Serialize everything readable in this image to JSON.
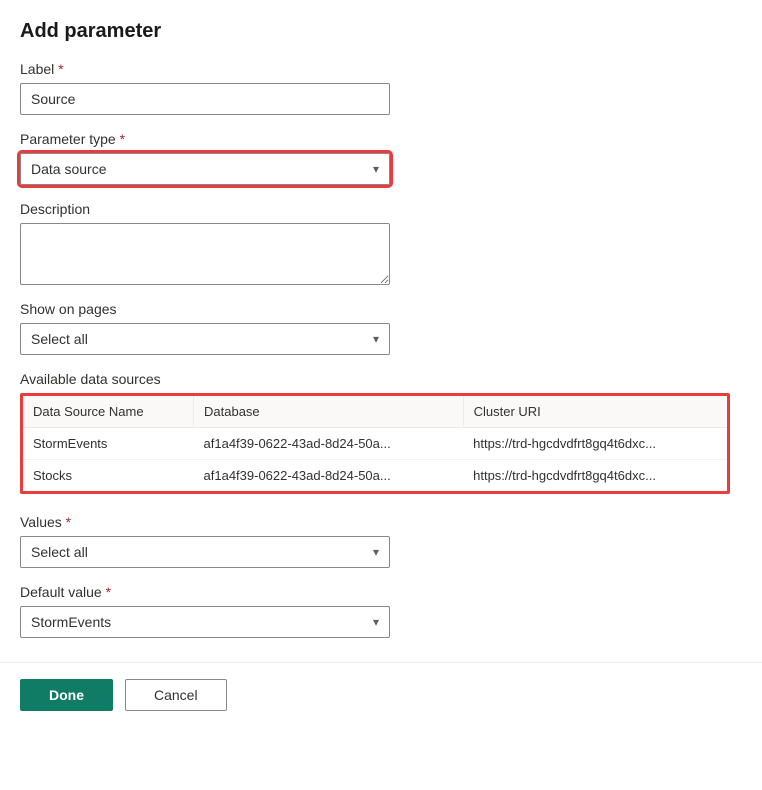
{
  "title": "Add parameter",
  "labels": {
    "label": "Label",
    "parameter_type": "Parameter type",
    "description": "Description",
    "show_on_pages": "Show on pages",
    "available_data_sources": "Available data sources",
    "values": "Values",
    "default_value": "Default value"
  },
  "fields": {
    "label_value": "Source",
    "parameter_type_value": "Data source",
    "description_value": "",
    "show_on_pages_value": "Select all",
    "values_value": "Select all",
    "default_value_value": "StormEvents"
  },
  "table": {
    "headers": {
      "name": "Data Source Name",
      "database": "Database",
      "cluster": "Cluster URI"
    },
    "rows": [
      {
        "name": "StormEvents",
        "database": "af1a4f39-0622-43ad-8d24-50a...",
        "cluster": "https://trd-hgcdvdfrt8gq4t6dxc..."
      },
      {
        "name": "Stocks",
        "database": "af1a4f39-0622-43ad-8d24-50a...",
        "cluster": "https://trd-hgcdvdfrt8gq4t6dxc..."
      }
    ]
  },
  "buttons": {
    "done": "Done",
    "cancel": "Cancel"
  }
}
